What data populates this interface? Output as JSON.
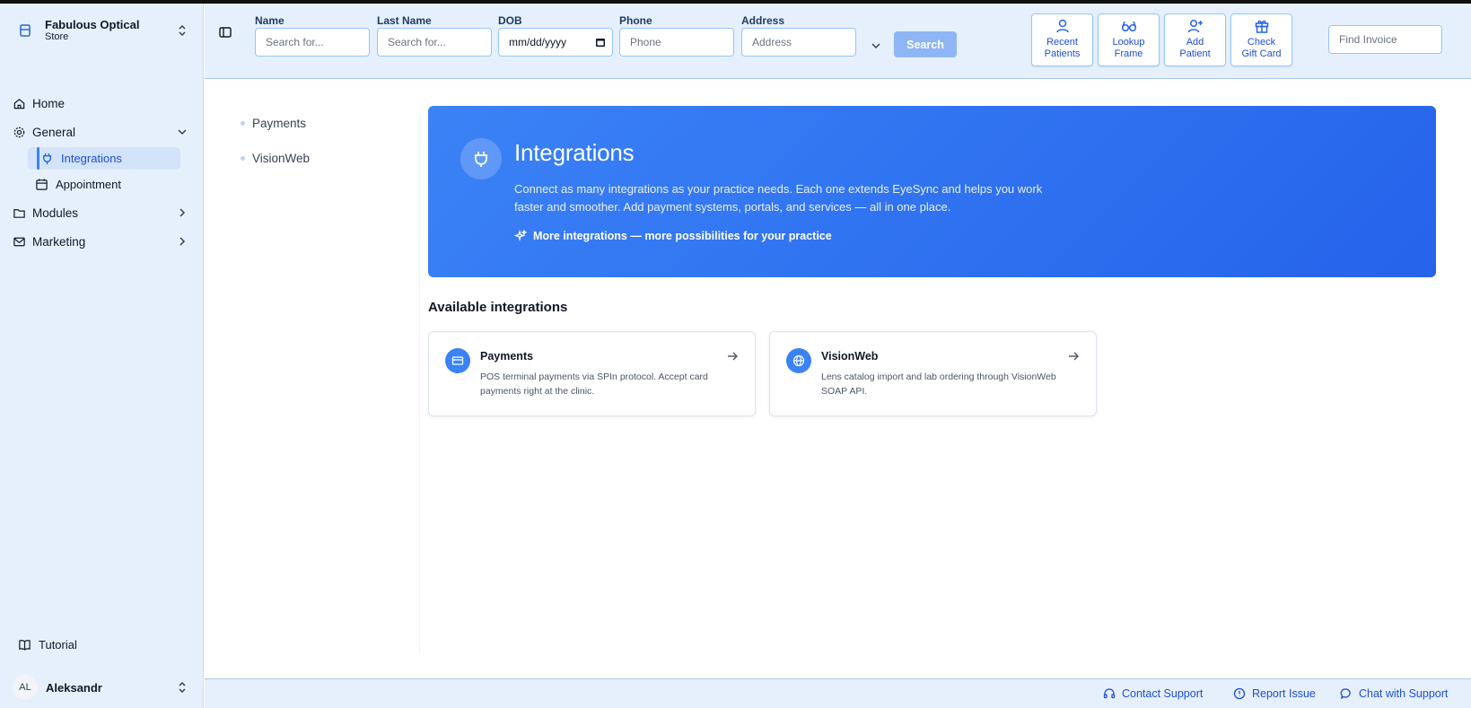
{
  "store": {
    "name": "Fabulous Optical",
    "type": "Store"
  },
  "sidebar": {
    "items": [
      {
        "label": "Home",
        "icon": "home-icon"
      },
      {
        "label": "General",
        "icon": "gear-icon"
      },
      {
        "label": "Modules",
        "icon": "folder-icon"
      },
      {
        "label": "Marketing",
        "icon": "mail-icon"
      }
    ],
    "general_sub": [
      {
        "label": "Integrations",
        "icon": "plug-icon"
      },
      {
        "label": "Appointment",
        "icon": "calendar-icon"
      }
    ],
    "tutorial": "Tutorial",
    "user": {
      "initials": "AL",
      "name": "Aleksandr"
    }
  },
  "search": {
    "name_label": "Name",
    "name_placeholder": "Search for...",
    "last_label": "Last Name",
    "last_placeholder": "Search for...",
    "dob_label": "DOB",
    "dob_placeholder": "mm/dd/yyyy",
    "phone_label": "Phone",
    "phone_placeholder": "Phone",
    "address_label": "Address",
    "address_placeholder": "Address",
    "button": "Search"
  },
  "quick_actions": [
    {
      "line1": "Recent",
      "line2": "Patients",
      "icon": "user-icon"
    },
    {
      "line1": "Lookup",
      "line2": "Frame",
      "icon": "glasses-icon"
    },
    {
      "line1": "Add",
      "line2": "Patient",
      "icon": "user-plus-icon"
    },
    {
      "line1": "Check",
      "line2": "Gift Card",
      "icon": "gift-icon"
    }
  ],
  "find_invoice": "Find Invoice",
  "toc": [
    "Payments",
    "VisionWeb"
  ],
  "hero": {
    "title": "Integrations",
    "description": "Connect as many integrations as your practice needs. Each one extends EyeSync and helps you work faster and smoother. Add payment systems, portals, and services — all in one place.",
    "tagline": "More integrations — more possibilities for your practice"
  },
  "available_title": "Available integrations",
  "cards": [
    {
      "title": "Payments",
      "description": "POS terminal payments via SPIn protocol. Accept card payments right at the clinic.",
      "icon": "credit-card-icon"
    },
    {
      "title": "VisionWeb",
      "description": "Lens catalog import and lab ordering through VisionWeb SOAP API.",
      "icon": "globe-icon"
    }
  ],
  "footer": {
    "contact": "Contact Support",
    "report": "Report Issue",
    "chat": "Chat with Support"
  },
  "colors": {
    "accent": "#3b82f6",
    "sidebar_bg": "#e6f0fc",
    "hero": "#2563eb"
  }
}
